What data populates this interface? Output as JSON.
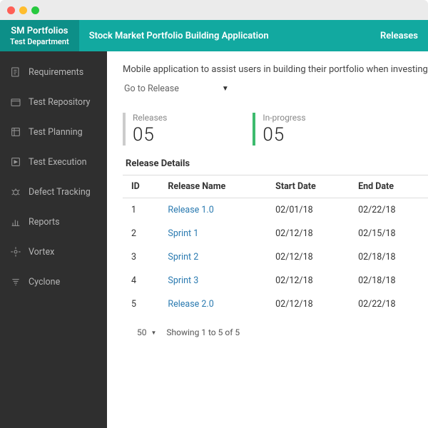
{
  "header": {
    "brand_title": "SM Portfolios",
    "brand_sub": "Test Department",
    "app_title": "Stock Market Portfolio Building Application",
    "nav_releases": "Releases"
  },
  "sidebar": {
    "items": [
      {
        "label": "Requirements"
      },
      {
        "label": "Test Repository"
      },
      {
        "label": "Test Planning"
      },
      {
        "label": "Test Execution"
      },
      {
        "label": "Defect Tracking"
      },
      {
        "label": "Reports"
      },
      {
        "label": "Vortex"
      },
      {
        "label": "Cyclone"
      }
    ]
  },
  "main": {
    "description": "Mobile application to assist users in building their portfolio when investing",
    "release_select": "Go to Release",
    "stats": {
      "releases_label": "Releases",
      "releases_value": "05",
      "inprogress_label": "In-progress",
      "inprogress_value": "05"
    },
    "table": {
      "title": "Release Details",
      "headers": {
        "id": "ID",
        "name": "Release Name",
        "start": "Start Date",
        "end": "End Date"
      },
      "rows": [
        {
          "id": "1",
          "name": "Release 1.0",
          "start": "02/01/18",
          "end": "02/22/18"
        },
        {
          "id": "2",
          "name": "Sprint 1",
          "start": "02/12/18",
          "end": "02/15/18"
        },
        {
          "id": "3",
          "name": "Sprint 2",
          "start": "02/12/18",
          "end": "02/18/18"
        },
        {
          "id": "4",
          "name": "Sprint 3",
          "start": "02/12/18",
          "end": "02/18/18"
        },
        {
          "id": "5",
          "name": "Release 2.0",
          "start": "02/12/18",
          "end": "02/22/18"
        }
      ]
    },
    "pager": {
      "page_size": "50",
      "summary": "Showing 1 to 5 of 5"
    }
  }
}
